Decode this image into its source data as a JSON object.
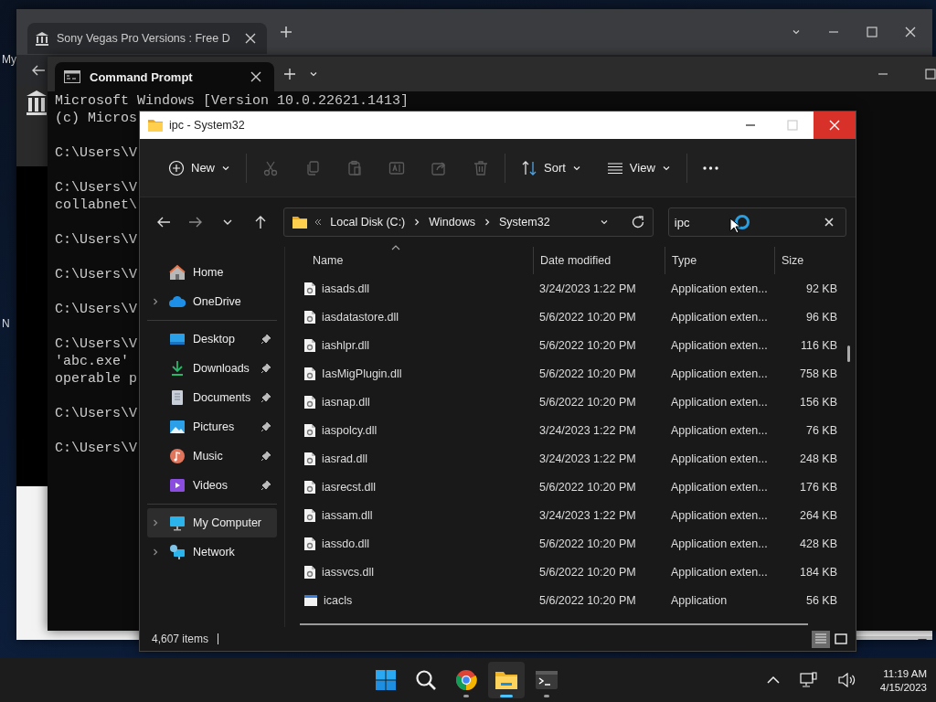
{
  "desktop_icons": [
    {
      "label": "My"
    },
    {
      "label": "N"
    }
  ],
  "browser": {
    "tab": {
      "title": "Sony Vegas Pro Versions : Free D"
    }
  },
  "terminal": {
    "tab": {
      "title": "Command Prompt"
    },
    "paragraphs": [
      {
        "lines": [
          "Microsoft Windows [Version 10.0.22621.1413]",
          "(c) Micros"
        ]
      },
      {
        "lines": [
          "C:\\Users\\V"
        ]
      },
      {
        "lines": [
          "C:\\Users\\V",
          "collabnet\\"
        ]
      },
      {
        "lines": [
          "C:\\Users\\V"
        ]
      },
      {
        "lines": [
          "C:\\Users\\V"
        ]
      },
      {
        "lines": [
          "C:\\Users\\V"
        ]
      },
      {
        "lines": [
          "C:\\Users\\V",
          "'abc.exe'",
          "operable p"
        ]
      },
      {
        "lines": [
          "C:\\Users\\V"
        ]
      },
      {
        "lines": [
          "C:\\Users\\V"
        ]
      }
    ]
  },
  "explorer": {
    "title": "ipc - System32",
    "window_controls": [
      {
        "kind": "minimize",
        "disabled": false
      },
      {
        "kind": "maximize",
        "disabled": true
      },
      {
        "kind": "close",
        "disabled": false
      }
    ],
    "toolbar": {
      "groups": [
        {
          "items": [
            {
              "kind": "new",
              "label": "New",
              "disabled": false
            }
          ]
        },
        {
          "items": [
            {
              "kind": "cut",
              "disabled": true
            },
            {
              "kind": "copy",
              "disabled": true
            },
            {
              "kind": "paste",
              "disabled": true
            },
            {
              "kind": "rename",
              "disabled": true
            },
            {
              "kind": "share",
              "disabled": true
            },
            {
              "kind": "delete",
              "disabled": true
            }
          ]
        },
        {
          "items": [
            {
              "kind": "sort",
              "label": "Sort",
              "disabled": false
            },
            {
              "kind": "view",
              "label": "View",
              "disabled": false
            }
          ]
        },
        {
          "items": [
            {
              "kind": "more",
              "disabled": false
            }
          ]
        }
      ]
    },
    "nav": [
      {
        "kind": "back",
        "disabled": false
      },
      {
        "kind": "forward",
        "disabled": true
      },
      {
        "kind": "recent",
        "disabled": false
      },
      {
        "kind": "up",
        "disabled": false
      }
    ],
    "address": {
      "crumbs": [
        "Local Disk (C:)",
        "Windows",
        "System32"
      ]
    },
    "search": {
      "value": "ipc"
    },
    "sidebar": {
      "sections": [
        {
          "items": [
            {
              "label": "Home",
              "kind": "home",
              "expandable": false,
              "pinned": false,
              "selected": false
            },
            {
              "label": "OneDrive",
              "kind": "cloud",
              "expandable": true,
              "pinned": false,
              "selected": false
            }
          ]
        },
        {
          "items": [
            {
              "label": "Desktop",
              "kind": "desktop",
              "expandable": false,
              "pinned": true,
              "selected": false
            },
            {
              "label": "Downloads",
              "kind": "downloads",
              "expandable": false,
              "pinned": true,
              "selected": false
            },
            {
              "label": "Documents",
              "kind": "documents",
              "expandable": false,
              "pinned": true,
              "selected": false
            },
            {
              "label": "Pictures",
              "kind": "pictures",
              "expandable": false,
              "pinned": true,
              "selected": false
            },
            {
              "label": "Music",
              "kind": "music",
              "expandable": false,
              "pinned": true,
              "selected": false
            },
            {
              "label": "Videos",
              "kind": "videos",
              "expandable": false,
              "pinned": true,
              "selected": false
            }
          ]
        },
        {
          "items": [
            {
              "label": "My Computer",
              "kind": "computer",
              "expandable": true,
              "pinned": false,
              "selected": true
            },
            {
              "label": "Network",
              "kind": "network",
              "expandable": true,
              "pinned": false,
              "selected": false
            }
          ]
        }
      ]
    },
    "table": {
      "columns": [
        {
          "label": "Name",
          "sorted": true
        },
        {
          "label": "Date modified",
          "sorted": false
        },
        {
          "label": "Type",
          "sorted": false
        },
        {
          "label": "Size",
          "sorted": false
        }
      ],
      "rows": [
        {
          "kind": "dll",
          "name": "iasads.dll",
          "date": "3/24/2023 1:22 PM",
          "type": "Application exten...",
          "size": "92 KB"
        },
        {
          "kind": "dll",
          "name": "iasdatastore.dll",
          "date": "5/6/2022 10:20 PM",
          "type": "Application exten...",
          "size": "96 KB"
        },
        {
          "kind": "dll",
          "name": "iashlpr.dll",
          "date": "5/6/2022 10:20 PM",
          "type": "Application exten...",
          "size": "116 KB"
        },
        {
          "kind": "dll",
          "name": "IasMigPlugin.dll",
          "date": "5/6/2022 10:20 PM",
          "type": "Application exten...",
          "size": "758 KB"
        },
        {
          "kind": "dll",
          "name": "iasnap.dll",
          "date": "5/6/2022 10:20 PM",
          "type": "Application exten...",
          "size": "156 KB"
        },
        {
          "kind": "dll",
          "name": "iaspolcy.dll",
          "date": "3/24/2023 1:22 PM",
          "type": "Application exten...",
          "size": "76 KB"
        },
        {
          "kind": "dll",
          "name": "iasrad.dll",
          "date": "3/24/2023 1:22 PM",
          "type": "Application exten...",
          "size": "248 KB"
        },
        {
          "kind": "dll",
          "name": "iasrecst.dll",
          "date": "5/6/2022 10:20 PM",
          "type": "Application exten...",
          "size": "176 KB"
        },
        {
          "kind": "dll",
          "name": "iassam.dll",
          "date": "3/24/2023 1:22 PM",
          "type": "Application exten...",
          "size": "264 KB"
        },
        {
          "kind": "dll",
          "name": "iassdo.dll",
          "date": "5/6/2022 10:20 PM",
          "type": "Application exten...",
          "size": "428 KB"
        },
        {
          "kind": "dll",
          "name": "iassvcs.dll",
          "date": "5/6/2022 10:20 PM",
          "type": "Application exten...",
          "size": "184 KB"
        },
        {
          "kind": "app",
          "name": "icacls",
          "date": "5/6/2022 10:20 PM",
          "type": "Application",
          "size": "56 KB"
        }
      ]
    },
    "status": {
      "count": "4,607 items"
    },
    "views": [
      {
        "kind": "details",
        "selected": true
      },
      {
        "kind": "tiles",
        "selected": false
      }
    ]
  },
  "taskbar": {
    "apps": [
      {
        "kind": "start",
        "running": false,
        "selected": false
      },
      {
        "kind": "search",
        "running": false,
        "selected": false
      },
      {
        "kind": "chrome",
        "running": true,
        "selected": false
      },
      {
        "kind": "explorer",
        "running": true,
        "selected": true
      },
      {
        "kind": "terminal",
        "running": true,
        "selected": false
      }
    ],
    "time": "11:19 AM",
    "date": "4/15/2023"
  }
}
